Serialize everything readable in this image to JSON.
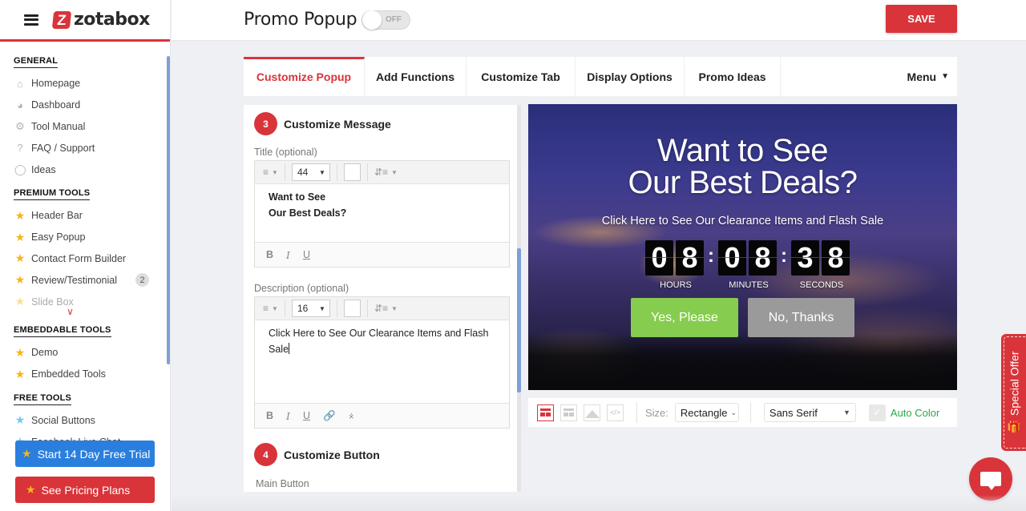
{
  "brand": {
    "name": "zotabox",
    "mark": "Z",
    "accent": "#d9343a"
  },
  "sidebar": {
    "sections": [
      {
        "title": "GENERAL",
        "items": [
          {
            "label": "Homepage",
            "icon": "home-icon"
          },
          {
            "label": "Dashboard",
            "icon": "gauge-icon"
          },
          {
            "label": "Tool Manual",
            "icon": "gear-icon"
          },
          {
            "label": "FAQ / Support",
            "icon": "question-icon"
          },
          {
            "label": "Ideas",
            "icon": "lightbulb-icon"
          }
        ]
      },
      {
        "title": "PREMIUM TOOLS",
        "items": [
          {
            "label": "Header Bar",
            "icon": "star-icon"
          },
          {
            "label": "Easy Popup",
            "icon": "star-icon"
          },
          {
            "label": "Contact Form Builder",
            "icon": "star-icon"
          },
          {
            "label": "Review/Testimonial",
            "icon": "star-icon",
            "badge": "2"
          },
          {
            "label": "Slide Box",
            "icon": "star-icon"
          }
        ]
      },
      {
        "title": "EMBEDDABLE TOOLS",
        "items": [
          {
            "label": "Demo",
            "icon": "star-icon"
          },
          {
            "label": "Embedded Tools",
            "icon": "star-icon"
          }
        ]
      },
      {
        "title": "FREE TOOLS",
        "items": [
          {
            "label": "Social Buttons",
            "icon": "star-blue-icon"
          },
          {
            "label": "Facebook Live Chat",
            "icon": "star-blue-icon"
          }
        ]
      }
    ],
    "cta_trial": "Start 14 Day Free Trial",
    "cta_pricing": "See Pricing Plans"
  },
  "header": {
    "title": "Promo Popup",
    "toggle_state": "OFF",
    "save_label": "SAVE"
  },
  "tabs": [
    {
      "label": "Customize Popup",
      "active": true
    },
    {
      "label": "Add Functions"
    },
    {
      "label": "Customize Tab"
    },
    {
      "label": "Display Options"
    },
    {
      "label": "Promo Ideas"
    },
    {
      "label": "Menu"
    }
  ],
  "editor": {
    "step3": {
      "num": "3",
      "title": "Customize Message"
    },
    "title_field": {
      "label": "Title (optional)",
      "font_size": "44",
      "lines": [
        "Want to See",
        "Our Best Deals?"
      ]
    },
    "desc_field": {
      "label": "Description (optional)",
      "font_size": "16",
      "text": "Click Here to See Our Clearance Items and Flash Sale"
    },
    "format": {
      "bold": "B",
      "italic": "I",
      "underline": "U"
    },
    "step4": {
      "num": "4",
      "title": "Customize Button"
    },
    "main_button_label": "Main Button"
  },
  "preview": {
    "title_line1": "Want to See",
    "title_line2": "Our Best Deals?",
    "description": "Click Here to See Our Clearance Items and Flash Sale",
    "countdown": {
      "hours": [
        "0",
        "8"
      ],
      "minutes": [
        "0",
        "8"
      ],
      "seconds": [
        "3",
        "8"
      ],
      "labels": {
        "hours": "HOURS",
        "minutes": "MINUTES",
        "seconds": "SECONDS"
      },
      "separator": ":"
    },
    "yes_button": "Yes, Please",
    "no_button": "No, Thanks",
    "yes_color": "#86cc4f",
    "no_color": "#9a9a9a"
  },
  "preview_toolbar": {
    "size_label": "Size:",
    "size_value": "Rectangle",
    "font_value": "Sans Serif",
    "auto_color_label": "Auto Color",
    "code_icon_text": "</>"
  },
  "special_offer": {
    "label": "Special Offer"
  }
}
